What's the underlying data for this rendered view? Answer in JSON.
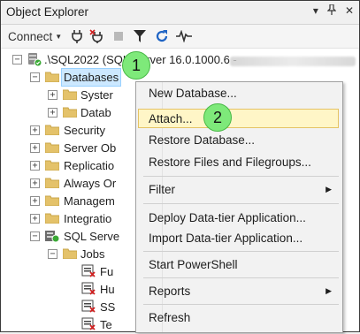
{
  "window": {
    "title": "Object Explorer",
    "controls": [
      "▾",
      "ᵖ",
      "✕"
    ]
  },
  "toolbar": {
    "connect_label": "Connect",
    "items": [
      "connect-dropdown",
      "connect-icon",
      "disconnect-icon",
      "stop-icon",
      "filter-icon",
      "refresh-icon",
      "activity-monitor-icon"
    ]
  },
  "tree": {
    "server_label": ".\\SQL2022 (SQL Server 16.0.1000.6 - ",
    "databases_label": "Databases",
    "system_label": "Syster",
    "snap_label": "Datab",
    "security_label": "Security",
    "server_objects_label": "Server Ob",
    "replication_label": "Replicatio",
    "always_on_label": "Always Or",
    "management_label": "Managem",
    "integration_label": "Integratio",
    "agent_label": "SQL Serve",
    "jobs_label": "Jobs",
    "job_items": [
      "Fu",
      "Hu",
      "SS",
      "Te"
    ]
  },
  "context_menu": {
    "items": [
      {
        "label": "New Database..."
      },
      {
        "label": "Attach..."
      },
      {
        "label": "Restore Database..."
      },
      {
        "label": "Restore Files and Filegroups..."
      },
      {
        "label": "Filter"
      },
      {
        "label": "Deploy Data-tier Application..."
      },
      {
        "label": "Import Data-tier Application..."
      },
      {
        "label": "Start PowerShell"
      },
      {
        "label": "Reports"
      },
      {
        "label": "Refresh"
      }
    ]
  },
  "annotations": {
    "step1": "1",
    "step2": "2"
  },
  "colors": {
    "badge_fill": "#7ee97a",
    "selection": "#cce8ff",
    "menu_highlight": "#fff6c7"
  }
}
